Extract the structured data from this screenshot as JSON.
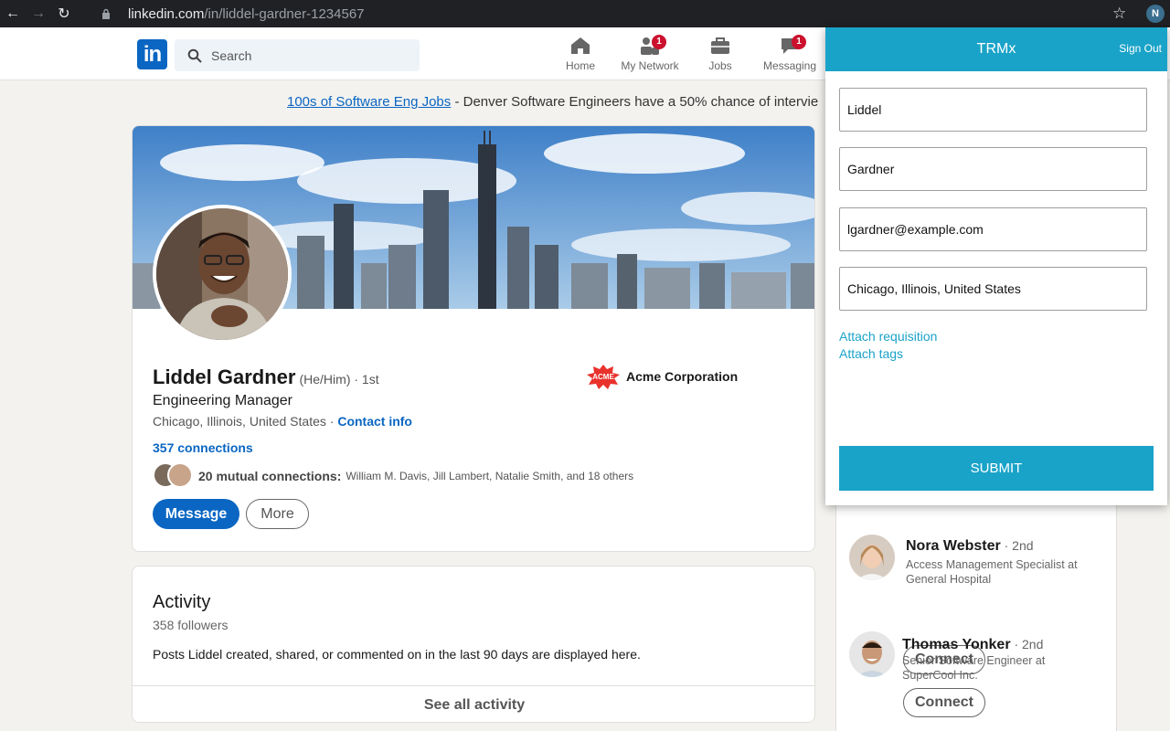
{
  "browser": {
    "url_domain": "linkedin.com",
    "url_path": "/in/liddel-gardner-1234567"
  },
  "linkedin": {
    "search_placeholder": "Search",
    "nav": {
      "home": "Home",
      "network": "My Network",
      "network_badge": "1",
      "jobs": "Jobs",
      "messaging": "Messaging",
      "messaging_badge": "1"
    },
    "ad": {
      "link": "100s of Software Eng Jobs",
      "text": " - Denver Software Engineers have a 50% chance of intervie"
    }
  },
  "profile": {
    "name": "Liddel Gardner",
    "pronouns": "(He/Him) · 1st",
    "headline": "Engineering Manager",
    "location": "Chicago, Illinois, United States · ",
    "contact_info": "Contact info",
    "connections": "357 connections",
    "mutual_count": "20 mutual connections:",
    "mutual_names": "William M. Davis, Jill Lambert, Natalie Smith, and 18 others",
    "message_label": "Message",
    "more_label": "More",
    "company": "Acme Corporation",
    "company_logo_text": "ACME"
  },
  "activity": {
    "title": "Activity",
    "followers": "358 followers",
    "description": "Posts Liddel created, shared, or commented on in the last 90 days are displayed here.",
    "see_all": "See all activity"
  },
  "people": [
    {
      "name": "Nora Webster",
      "degree": " · 2nd",
      "desc": "Access Management Specialist at General Hospital",
      "button": "Connect"
    },
    {
      "name": "Thomas Yonker",
      "degree": " · 2nd",
      "desc": "Senior Software Engineer at SuperCool Inc.",
      "button": "Connect"
    }
  ],
  "trmx": {
    "title": "TRMx",
    "sign_out": "Sign Out",
    "first_name": "Liddel",
    "last_name": "Gardner",
    "email": "lgardner@example.com",
    "location": "Chicago, Illinois, United States",
    "attach_requisition": "Attach requisition",
    "attach_tags": "Attach tags",
    "submit": "SUBMIT"
  },
  "colors": {
    "linkedin_blue": "#0a66c2",
    "trmx_teal": "#1aa3c8",
    "badge_red": "#cb112d"
  }
}
